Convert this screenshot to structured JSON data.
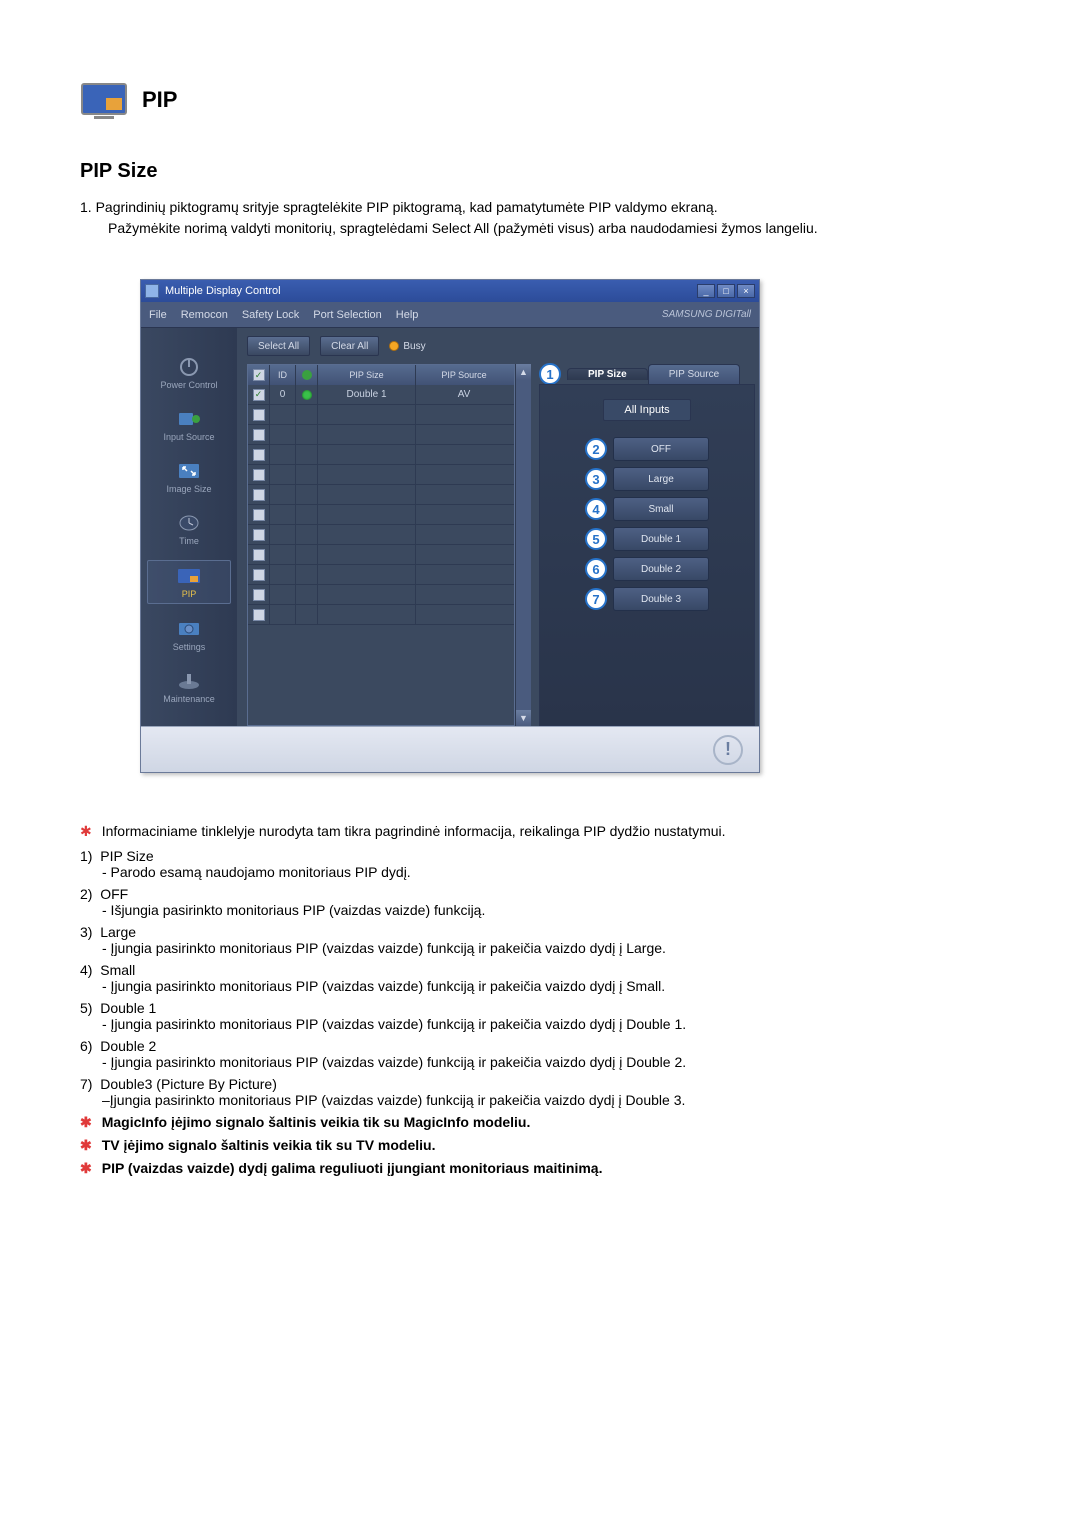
{
  "header": {
    "title": "PIP"
  },
  "section": {
    "title": "PIP Size"
  },
  "intro": {
    "line1": "1. Pagrindinių piktogramų srityje spragtelėkite PIP piktogramą, kad pamatytumėte PIP valdymo ekraną.",
    "line2": "Pažymėkite norimą valdyti monitorių, spragtelėdami Select All (pažymėti visus) arba naudodamiesi žymos langeliu."
  },
  "app": {
    "title": "Multiple Display Control",
    "menus": [
      "File",
      "Remocon",
      "Safety Lock",
      "Port Selection",
      "Help"
    ],
    "brand": "SAMSUNG DIGITall",
    "buttons": {
      "selectAll": "Select All",
      "clearAll": "Clear All",
      "busy": "Busy"
    },
    "sidebar": [
      {
        "label": "Power Control"
      },
      {
        "label": "Input Source"
      },
      {
        "label": "Image Size"
      },
      {
        "label": "Time"
      },
      {
        "label": "PIP",
        "active": true
      },
      {
        "label": "Settings"
      },
      {
        "label": "Maintenance"
      }
    ],
    "grid": {
      "cols": {
        "chk": "",
        "id": "ID",
        "led": "",
        "pipsize": "PIP Size",
        "pipsource": "PIP Source"
      },
      "rows_count": 12,
      "row0": {
        "checked": true,
        "id": "0",
        "led": true,
        "pipsize": "Double 1",
        "pipsource": "AV"
      }
    },
    "tabs": {
      "pipsize": "PIP Size",
      "pipsource": "PIP Source"
    },
    "panel": {
      "header": "All Inputs",
      "options": [
        "OFF",
        "Large",
        "Small",
        "Double 1",
        "Double 2",
        "Double 3"
      ]
    },
    "callouts": [
      "1",
      "2",
      "3",
      "4",
      "5",
      "6",
      "7"
    ]
  },
  "infostar": "Informaciniame tinklelyje nurodyta tam tikra pagrindinė informacija, reikalinga PIP dydžio nustatymui.",
  "items": [
    {
      "n": "1)",
      "title": "PIP Size",
      "desc": "- Parodo esamą naudojamo monitoriaus PIP dydį."
    },
    {
      "n": "2)",
      "title": "OFF",
      "desc": "- Išjungia pasirinkto monitoriaus PIP (vaizdas vaizde) funkciją."
    },
    {
      "n": "3)",
      "title": "Large",
      "desc": "- Įjungia pasirinkto monitoriaus PIP (vaizdas vaizde) funkciją ir pakeičia vaizdo dydį į Large."
    },
    {
      "n": "4)",
      "title": "Small",
      "desc": "- Įjungia pasirinkto monitoriaus PIP (vaizdas vaizde) funkciją ir pakeičia vaizdo dydį į Small."
    },
    {
      "n": "5)",
      "title": "Double 1",
      "desc": "- Įjungia pasirinkto monitoriaus PIP (vaizdas vaizde) funkciją ir pakeičia vaizdo dydį į Double 1."
    },
    {
      "n": "6)",
      "title": "Double 2",
      "desc": "- Įjungia pasirinkto monitoriaus PIP (vaizdas vaizde) funkciją ir pakeičia vaizdo dydį į Double 2."
    },
    {
      "n": "7)",
      "title": "Double3 (Picture By Picture)",
      "desc": "–Įjungia pasirinkto monitoriaus PIP (vaizdas vaizde) funkciją ir pakeičia vaizdo dydį į Double 3."
    }
  ],
  "boldlines": [
    "MagicInfo įėjimo signalo šaltinis veikia tik su MagicInfo modeliu.",
    "TV įėjimo signalo šaltinis veikia tik su TV modeliu.",
    "PIP (vaizdas vaizde) dydį galima reguliuoti įjungiant monitoriaus maitinimą."
  ]
}
